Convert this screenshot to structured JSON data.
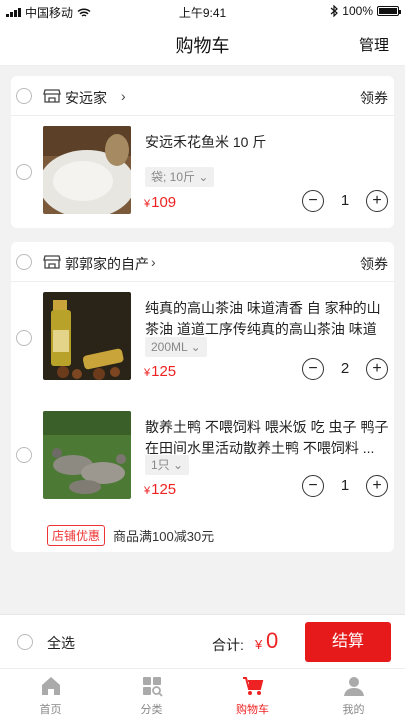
{
  "status_bar": {
    "carrier": "中国移动",
    "time": "上午9:41",
    "battery": "100%"
  },
  "header": {
    "title": "购物车",
    "manage": "管理"
  },
  "stores": [
    {
      "name": "安远家",
      "coupon": "领券",
      "items": [
        {
          "title": "安远禾花鱼米 10 斤",
          "spec": "袋; 10斤",
          "price": "109",
          "qty": "1"
        }
      ]
    },
    {
      "name": "郭郭家的自产",
      "coupon": "领券",
      "items": [
        {
          "title": "纯真的高山茶油 味道清香 自 家种的山茶油 道道工序传纯真的高山茶油 味道清...",
          "spec": "200ML",
          "price": "125",
          "qty": "2"
        },
        {
          "title": "散养土鸭 不喂饲料 喂米饭 吃 虫子 鸭子在田间水里活动散养土鸭 不喂饲料 ...",
          "spec": "1只",
          "price": "125",
          "qty": "1"
        }
      ],
      "promo": {
        "badge": "店铺优惠",
        "text": "商品满100减30元"
      }
    }
  ],
  "checkout": {
    "select_all": "全选",
    "total_label": "合计:",
    "currency": "¥",
    "total": "0",
    "button": "结算"
  },
  "tabs": [
    {
      "label": "首页",
      "icon": "home-icon"
    },
    {
      "label": "分类",
      "icon": "category-icon"
    },
    {
      "label": "购物车",
      "icon": "cart-icon",
      "active": true
    },
    {
      "label": "我的",
      "icon": "profile-icon"
    }
  ],
  "colors": {
    "accent": "#e61a1a",
    "background": "#f2f2f2"
  }
}
